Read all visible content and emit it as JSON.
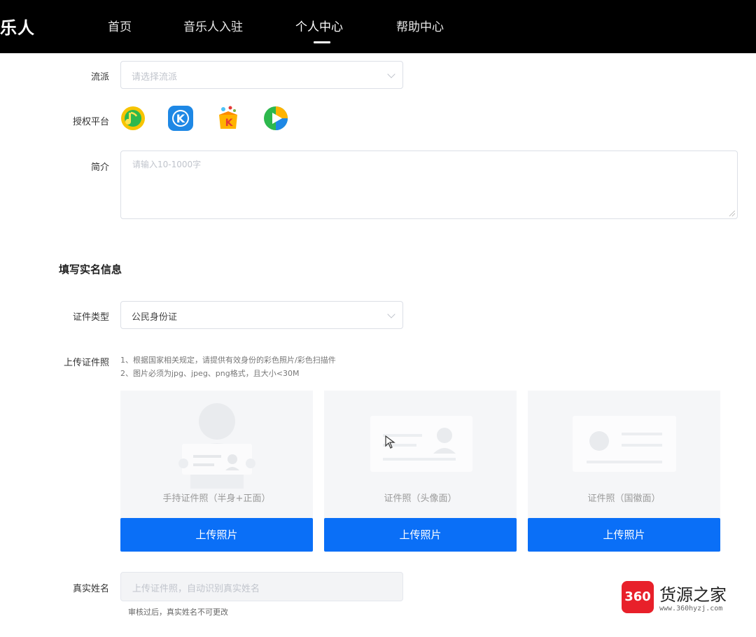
{
  "logo": "乐人",
  "nav": {
    "items": [
      {
        "label": "首页"
      },
      {
        "label": "音乐人入驻"
      },
      {
        "label": "个人中心"
      },
      {
        "label": "帮助中心"
      }
    ],
    "active_index": 2
  },
  "form": {
    "genre_label": "流派",
    "genre_placeholder": "请选择流派",
    "platform_label": "授权平台",
    "platforms": [
      {
        "icon": "qq-music-icon",
        "color": "#f7c400"
      },
      {
        "icon": "kugou-music-icon",
        "color": "#1e88e5"
      },
      {
        "icon": "kuwo-music-icon",
        "color": "#ff8a00"
      },
      {
        "icon": "platform-4-icon",
        "color": "#2db84d"
      }
    ],
    "intro_label": "简介",
    "intro_placeholder": "请输入10-1000字"
  },
  "realname": {
    "section_title": "填写实名信息",
    "id_type_label": "证件类型",
    "id_type_value": "公民身份证",
    "upload_label": "上传证件照",
    "hints": [
      "1、根据国家相关规定，请提供有效身份的彩色照片/彩色扫描件",
      "2、图片必须为jpg、jpeg、png格式，且大小<30M"
    ],
    "cards": [
      {
        "caption": "手持证件照（半身+正面）",
        "button": "上传照片"
      },
      {
        "caption": "证件照（头像面）",
        "button": "上传照片"
      },
      {
        "caption": "证件照（国徽面）",
        "button": "上传照片"
      }
    ],
    "name_label": "真实姓名",
    "name_placeholder": "上传证件照，自动识别真实姓名",
    "name_note": "审核过后，真实姓名不可更改"
  },
  "watermark": {
    "badge": "360",
    "title": "货源之家",
    "url": "www.360hyzj.com"
  }
}
